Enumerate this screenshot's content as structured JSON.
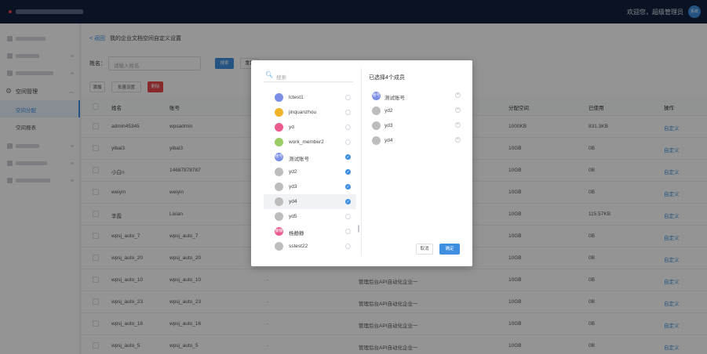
{
  "header": {
    "welcome": "欢迎您，超级管理员",
    "avatar_text": "系统"
  },
  "sidebar": {
    "section_label": "空间管理",
    "sub_items": [
      {
        "label": "空间分配"
      },
      {
        "label": "空间报表"
      }
    ]
  },
  "breadcrumb": {
    "back": "< 返回",
    "title": "我的企业文档空间自定义设置"
  },
  "search": {
    "label": "姓名：",
    "placeholder": "请输入姓名",
    "search_button": "搜索",
    "reset_button": "重置"
  },
  "toolbar": {
    "add": "添加",
    "batch": "批量设置",
    "delete": "删除"
  },
  "table": {
    "columns": {
      "name": "姓名",
      "account": "账号",
      "alloc": "分配空间",
      "used": "已使用",
      "op": "操作"
    },
    "rows": [
      {
        "name": "admin45345",
        "account": "wpsadmin",
        "dash": "",
        "org": "",
        "alloc": "1000KB",
        "used": "831.3KB",
        "op": "自定义"
      },
      {
        "name": "yibai3",
        "account": "yibai3",
        "dash": "",
        "org": "",
        "alloc": "10GB",
        "used": "0B",
        "op": "自定义"
      },
      {
        "name": "小白n",
        "account": "14687878787",
        "dash": "",
        "org": "",
        "alloc": "10GB",
        "used": "0B",
        "op": "自定义"
      },
      {
        "name": "weiyin",
        "account": "weiyin",
        "dash": "",
        "org": "",
        "alloc": "10GB",
        "used": "0B",
        "op": "自定义"
      },
      {
        "name": "李霞",
        "account": "Lixian",
        "dash": "",
        "org": "",
        "alloc": "10GB",
        "used": "115.57KB",
        "op": "自定义"
      },
      {
        "name": "wpsj_auto_7",
        "account": "wpsj_auto_7",
        "dash": "",
        "org": "",
        "alloc": "10GB",
        "used": "0B",
        "op": "自定义"
      },
      {
        "name": "wpsj_auto_20",
        "account": "wpsj_auto_20",
        "dash": "",
        "org": "",
        "alloc": "10GB",
        "used": "0B",
        "op": "自定义"
      },
      {
        "name": "wpsj_auto_10",
        "account": "wpsj_auto_10",
        "dash": "-",
        "org": "管理后台API自动化企业一",
        "alloc": "10GB",
        "used": "0B",
        "op": "自定义"
      },
      {
        "name": "wpsj_auto_23",
        "account": "wpsj_auto_23",
        "dash": "-",
        "org": "管理后台API自动化企业一",
        "alloc": "10GB",
        "used": "0B",
        "op": "自定义"
      },
      {
        "name": "wpsj_auto_16",
        "account": "wpsj_auto_16",
        "dash": "-",
        "org": "管理后台API自动化企业一",
        "alloc": "10GB",
        "used": "0B",
        "op": "自定义"
      },
      {
        "name": "wpsj_auto_5",
        "account": "wpsj_auto_5",
        "dash": "-",
        "org": "管理后台API自动化企业一",
        "alloc": "10GB",
        "used": "0B",
        "op": "自定义"
      }
    ]
  },
  "modal": {
    "search_placeholder": "搜索",
    "members": [
      {
        "name": "lctest1",
        "avatar": "",
        "color": "#7b8ee6",
        "checked": false
      },
      {
        "name": "jinquanzhou",
        "avatar": "",
        "color": "#f0b429",
        "checked": false
      },
      {
        "name": "yd",
        "avatar": "",
        "color": "#ec5b8f",
        "checked": false
      },
      {
        "name": "work_member2",
        "avatar": "",
        "color": "#9ccc65",
        "checked": false
      },
      {
        "name": "测试账号",
        "avatar": "账号",
        "color": "#7b8ee6",
        "checked": true
      },
      {
        "name": "yd2",
        "avatar": "",
        "color": "#bdbdbd",
        "checked": true
      },
      {
        "name": "yd3",
        "avatar": "",
        "color": "#bdbdbd",
        "checked": true
      },
      {
        "name": "yd4",
        "avatar": "",
        "color": "#bdbdbd",
        "checked": true
      },
      {
        "name": "yd5",
        "avatar": "",
        "color": "#bdbdbd",
        "checked": false
      },
      {
        "name": "杨静静",
        "avatar": "静静",
        "color": "#ec5b8f",
        "checked": false
      },
      {
        "name": "sstest22",
        "avatar": "",
        "color": "#bdbdbd",
        "checked": false
      }
    ],
    "selected_title": "已选择4个成员",
    "selected": [
      {
        "name": "测试账号",
        "avatar": "账号",
        "color": "#7b8ee6"
      },
      {
        "name": "yd2",
        "avatar": "",
        "color": "#bdbdbd"
      },
      {
        "name": "yd3",
        "avatar": "",
        "color": "#bdbdbd"
      },
      {
        "name": "yd4",
        "avatar": "",
        "color": "#bdbdbd"
      }
    ],
    "cancel": "取消",
    "confirm": "确定"
  },
  "colors": {
    "accent": "#3e8fe0",
    "danger": "#e8464a",
    "topbar": "#10213f"
  }
}
